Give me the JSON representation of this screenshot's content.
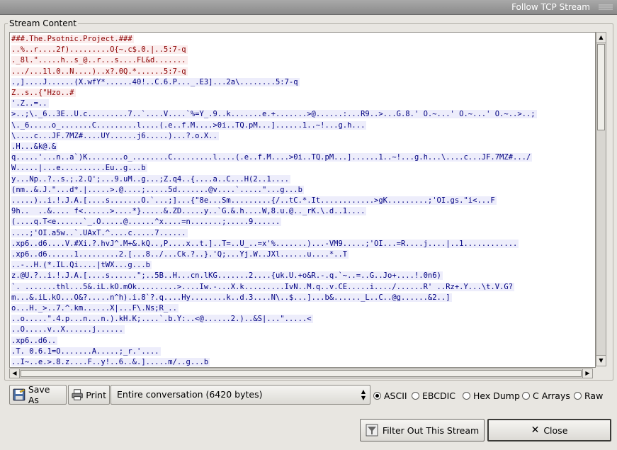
{
  "window": {
    "title": "Follow TCP Stream"
  },
  "group": {
    "label": "Stream Content"
  },
  "stream_lines": [
    {
      "dir": "client",
      "text": "###.The.Psotnic.Project.###"
    },
    {
      "dir": "client",
      "text": "..%..r....2f).........O{~.c$.0.|..5:7-q"
    },
    {
      "dir": "client",
      "text": "._8l.\".....h..s_@..r...s....FL&d......."
    },
    {
      "dir": "client",
      "text": ".../...1l.0..N....)..x?.0Q.*......5:7-q"
    },
    {
      "dir": "server",
      "text": ".,]....J......(X.wfY*......40!..C.6.P..._.E3]...2a\\........5:7-q"
    },
    {
      "dir": "client",
      "text": "Z..s..{\"Hzo..#"
    },
    {
      "dir": "server",
      "text": "'.Z..=.."
    },
    {
      "dir": "server",
      "text": ">..;\\._6..3E..U.c.........7..`....V....`%=Y_.9..k.......e.+.......>@......:...R9..>...G.8.' O.~...' O.~...' O.~..>..;"
    },
    {
      "dir": "server",
      "text": "\\._6.....o_.......C.........l....(.e..f.M....>0i..TQ.pM...]......1..~!...g.h..."
    },
    {
      "dir": "server",
      "text": "\\....c...JF.7MZ#....UY......j6.....)...?.o.X.."
    },
    {
      "dir": "server",
      "text": ".H...&k@.&"
    },
    {
      "dir": "server",
      "text": "q.....'...n..a`)K........o_........C.........l....(.e..f.M....>0i..TQ.pM...]......1..~!...g.h...\\....c...JF.7MZ#.../"
    },
    {
      "dir": "server",
      "text": "W.....|...e..........Eu..g...b"
    },
    {
      "dir": "server",
      "text": "y...Np..?..s.;.2.Q';...9.uM..g...;Z.q4..{....a..C...H(2..1...."
    },
    {
      "dir": "server",
      "text": "(nm..&.J.\"...d*.|.....>.@....;.....5d.......@v....`.....\"...g...b"
    },
    {
      "dir": "server",
      "text": ".....)..i.!.J.A.[....s.......O.`...;]...{\"8e...Sm.........{/..tC.*.It............>gK.........;'OI.gs.\"i<...F"
    },
    {
      "dir": "server",
      "text": "9h..  ..&.... f<......>....*}.....&.ZD.....y..`G.&.h....W,8.u.@.._rK.\\.d..1...."
    },
    {
      "dir": "server",
      "text": "(....q.T<e......`_.O.....@......^x....=n.......;.....9......"
    },
    {
      "dir": "server",
      "text": "....;'OI.a5w..`.UAxT.^....c.....7......"
    },
    {
      "dir": "server",
      "text": ".xp6..d6....V.#Xi.?.hvJ^.M+&.kQ..,P....x..t.]..T=..U_..=x'%.......)...-VM9.....;'OI...=R....j....|..1............"
    },
    {
      "dir": "server",
      "text": ".xp6..d6......1.........2.[...8../...Ck.?..}.'Q;...Yj.W..JXl......u....*..T"
    },
    {
      "dir": "server",
      "text": "..-..H.(*.IL.Qi....|tWX...g...b"
    },
    {
      "dir": "server",
      "text": "z.@U.?..i.!.J.A.[....s......\";..5B..H...cn.lKG.......2....{uk.U.+o&R.-.q.`~..=..G..Jo+....!.0n6)"
    },
    {
      "dir": "server",
      "text": "`. .......thl...5&.iL.kO.mOk.........>....Iw.-...X.k.........IvN..M.q..v.CE.....i..../......R' ..Rz+.Y...\\t.V.G?"
    },
    {
      "dir": "server",
      "text": "m...&.iL.kO...O&?.....n^h).i.8`?.q....Hy........k..d.3....N\\..$...]...b&......_L..C..@g......&2..]"
    },
    {
      "dir": "server",
      "text": "o...H._>..7.^.km......X|...F\\.Ns;R_.."
    },
    {
      "dir": "server",
      "text": "..o.....\".4.p...n...n.).kH.K;....`.b.Y:..<@......2.)..&S|...\".....<"
    },
    {
      "dir": "server",
      "text": "..O.....v..X......j......"
    },
    {
      "dir": "server",
      "text": ".xp6..d6.."
    },
    {
      "dir": "server",
      "text": ".T. 0.6.1=O.......A.....;_r.'...."
    },
    {
      "dir": "server",
      "text": "..I~..e.>.8.z....F..y!..6..&.].....m/..g...b"
    }
  ],
  "toolbar": {
    "save_as_label": "Save As",
    "print_label": "Print",
    "conversation_select": "Entire conversation (6420 bytes)"
  },
  "formats": [
    {
      "label": "ASCII",
      "checked": true
    },
    {
      "label": "EBCDIC",
      "checked": false
    },
    {
      "label": "Hex Dump",
      "checked": false
    },
    {
      "label": "C Arrays",
      "checked": false
    },
    {
      "label": "Raw",
      "checked": false
    }
  ],
  "actions": {
    "filter_label": "Filter Out This Stream",
    "close_label": "Close"
  },
  "colors": {
    "client_fg": "#8b0000",
    "client_bg": "#fbeded",
    "server_fg": "#000080",
    "server_bg": "#ededfb"
  }
}
